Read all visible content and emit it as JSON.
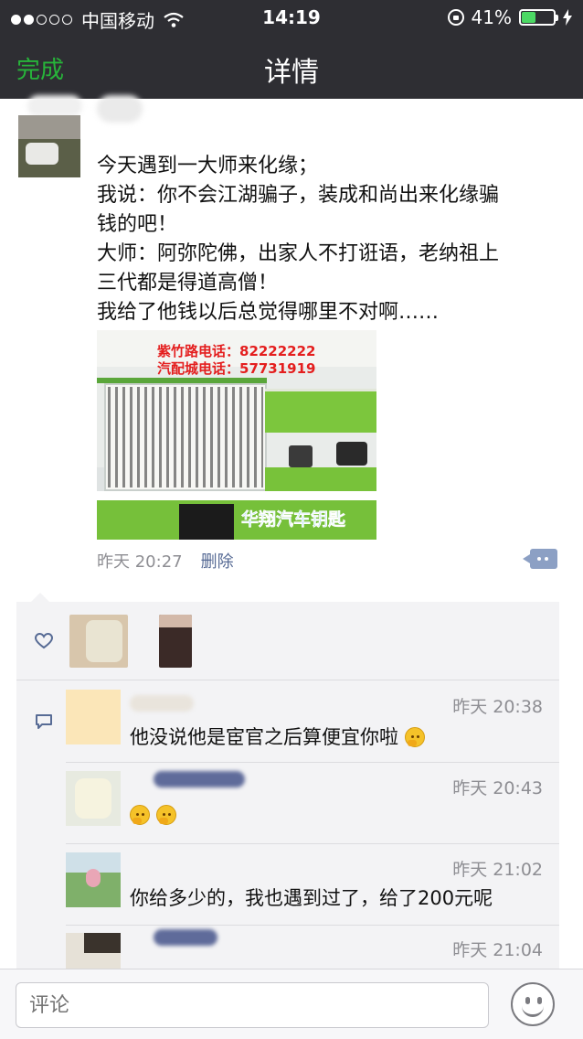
{
  "status_bar": {
    "carrier": "中国移动",
    "time": "14:19",
    "battery": "41%",
    "battery_level": 0.41
  },
  "nav": {
    "done_label": "完成",
    "title": "详情"
  },
  "post": {
    "lines": [
      "今天遇到一大师来化缘；",
      "我说：你不会江湖骗子，装成和尚出来化缘骗",
      "钱的吧！",
      "大师：阿弥陀佛，出家人不打诳语，老纳祖上",
      "三代都是得道高僧！",
      "我给了他钱以后总觉得哪里不对啊……"
    ],
    "photo": {
      "sign_line1": "紫竹路电话：82222222",
      "sign_line2": "汽配城电话：57731919",
      "brand": "华翔汽车钥匙"
    },
    "time": "昨天 20:27",
    "delete_label": "删除"
  },
  "comments": [
    {
      "time": "昨天 20:38",
      "text": "他没说他是宦官之后算便宜你啦",
      "emoji_count": 1
    },
    {
      "time": "昨天 20:43",
      "text": "",
      "emoji_count": 2
    },
    {
      "time": "昨天 21:02",
      "text": "你给多少的，我也遇到过了，给了200元呢",
      "emoji_count": 0
    },
    {
      "time": "昨天 21:04",
      "text": "",
      "emoji_count": 0
    }
  ],
  "input": {
    "placeholder": "评论"
  },
  "icons": {
    "wifi": "wifi-icon",
    "lock": "orientation-lock-icon",
    "battery": "battery-icon",
    "heart": "heart-icon",
    "comment": "comment-icon",
    "emoji": "emoji-face-icon"
  },
  "colors": {
    "nav_bg": "#2e2e33",
    "accent_green": "#27b43a",
    "link_blue": "#576b95",
    "panel_bg": "#f3f3f5"
  }
}
